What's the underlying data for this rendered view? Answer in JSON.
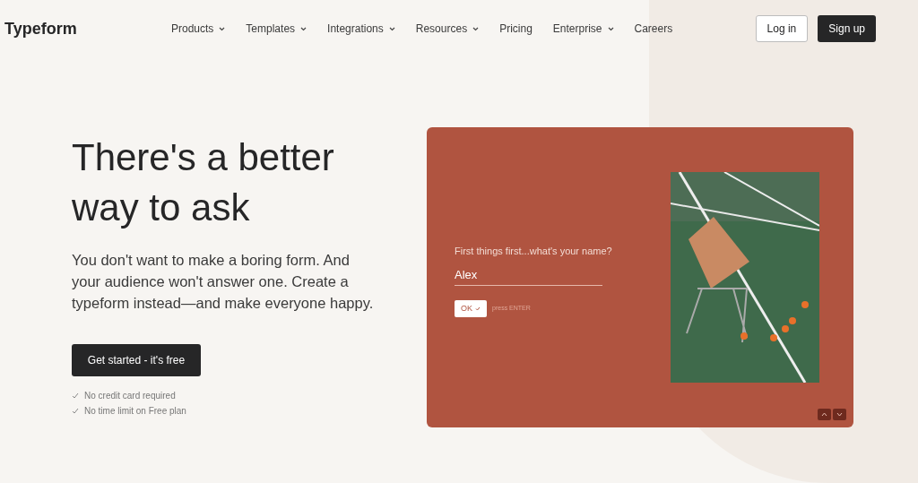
{
  "header": {
    "logo": "Typeform",
    "nav": [
      {
        "label": "Products",
        "dropdown": true
      },
      {
        "label": "Templates",
        "dropdown": true
      },
      {
        "label": "Integrations",
        "dropdown": true
      },
      {
        "label": "Resources",
        "dropdown": true
      },
      {
        "label": "Pricing",
        "dropdown": false
      },
      {
        "label": "Enterprise",
        "dropdown": true
      },
      {
        "label": "Careers",
        "dropdown": false
      }
    ],
    "login": "Log in",
    "signup": "Sign up"
  },
  "hero": {
    "title": "There's a better way to ask",
    "subtitle": "You don't want to make a boring form. And your audience won't answer one. Create a typeform instead—and make everyone happy.",
    "cta": "Get started - it's free",
    "perks": [
      "No credit card required",
      "No time limit on Free plan"
    ]
  },
  "demo": {
    "question": "First things first...what's your name?",
    "answer": "Alex",
    "ok": "OK",
    "hint": "press ENTER"
  }
}
